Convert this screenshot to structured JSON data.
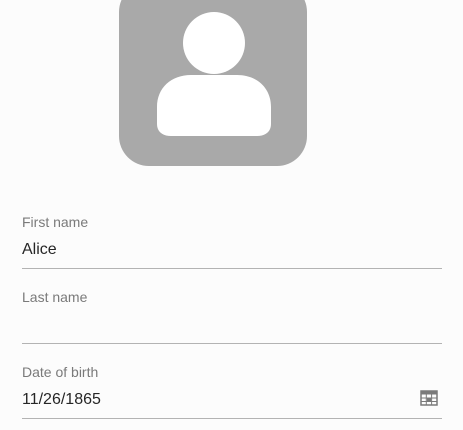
{
  "avatar": {
    "icon": "user-silhouette-icon",
    "color": "#a9a9a9"
  },
  "form": {
    "first_name": {
      "label": "First name",
      "value": "Alice"
    },
    "last_name": {
      "label": "Last name",
      "value": ""
    },
    "date_of_birth": {
      "label": "Date of birth",
      "value": "11/26/1865",
      "icon": "calendar-icon"
    }
  }
}
